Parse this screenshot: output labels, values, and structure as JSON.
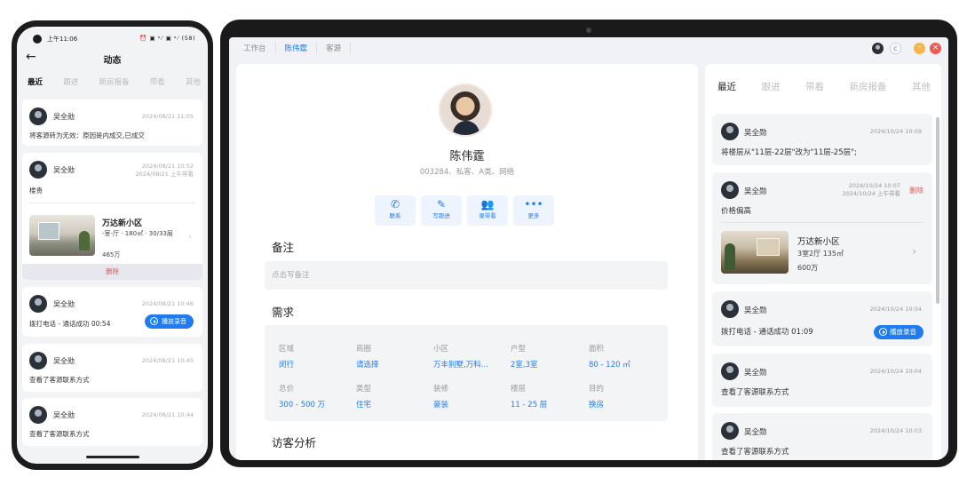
{
  "phone": {
    "status_time": "上午11:06",
    "status_icons": "⏰ ▣ ᵃᵢˡ ▣ ᵃᵢˡ (58)",
    "back_glyph": "←",
    "title": "动态",
    "tabs": [
      "最近",
      "跟进",
      "新房报备",
      "带看",
      "其他"
    ],
    "feed": [
      {
        "name": "吴全勋",
        "date": "2024/08/21 11:05",
        "text": "将客源转为无效：原因是内成交,已成交"
      },
      {
        "name": "吴全勋",
        "date": "2024/08/21 10:52",
        "date2": "2024/08/21 上午带看",
        "text": "楼贵",
        "house": {
          "name": "万达新小区",
          "info": "-室-厅 · 180㎡ · 30/33层",
          "price": "465万"
        },
        "delete_label": "删除"
      },
      {
        "name": "吴全勋",
        "date": "2024/08/21 10:46",
        "text": "拨打电话 - 通话成功 00:54",
        "play_label": "播放录音"
      },
      {
        "name": "吴全勋",
        "date": "2024/08/21 10:45",
        "text": "查看了客源联系方式"
      },
      {
        "name": "吴全勋",
        "date": "2024/08/21 10:44",
        "text": "查看了客源联系方式"
      }
    ]
  },
  "tablet": {
    "tabs": [
      "工作台",
      "陈伟霆",
      "客源"
    ],
    "active_tab": "陈伟霆",
    "window_icons": {
      "refresh": "c",
      "minimize": "–",
      "close": "×"
    },
    "profile": {
      "name": "陈伟霆",
      "sub": "003284、私客、A类、网络"
    },
    "actions": [
      {
        "icon": "phone-icon",
        "glyph": "✆",
        "label": "联系"
      },
      {
        "icon": "pen-icon",
        "glyph": "✎",
        "label": "写跟进"
      },
      {
        "icon": "people-icon",
        "glyph": "👥",
        "label": "录带看"
      },
      {
        "icon": "more-icon",
        "glyph": "•••",
        "label": "更多"
      }
    ],
    "note": {
      "title": "备注",
      "placeholder": "点击写备注"
    },
    "requirements": {
      "title": "需求",
      "fields": [
        {
          "label": "区域",
          "value": "闵行"
        },
        {
          "label": "商圈",
          "value": "请选择"
        },
        {
          "label": "小区",
          "value": "万丰别墅,万科..."
        },
        {
          "label": "户型",
          "value": "2室,3室"
        },
        {
          "label": "面积",
          "value": "80 - 120 ㎡"
        },
        {
          "label": "总价",
          "value": "300 - 500 万"
        },
        {
          "label": "类型",
          "value": "住宅"
        },
        {
          "label": "装修",
          "value": "豪装"
        },
        {
          "label": "楼层",
          "value": "11 - 25 层"
        },
        {
          "label": "目的",
          "value": "换房"
        }
      ]
    },
    "visitor_analysis_title": "访客分析",
    "side": {
      "tabs": [
        "最近",
        "跟进",
        "带看",
        "新房报备",
        "其他"
      ],
      "feed": [
        {
          "name": "吴全勋",
          "date": "2024/10/24 10:09",
          "text": "将楼层从\"11层-22层\"改为\"11层-25层\";"
        },
        {
          "name": "吴全勋",
          "date": "2024/10/24 10:07",
          "date2": "2024/10/24 上午带看",
          "delete_label": "删除",
          "text": "价格偏高",
          "house": {
            "name": "万达新小区",
            "info": "3室2厅   135㎡",
            "price": "600万"
          }
        },
        {
          "name": "吴全勋",
          "date": "2024/10/24 10:04",
          "text": "拨打电话 - 通话成功 01:09",
          "play_label": "播放录音"
        },
        {
          "name": "吴全勋",
          "date": "2024/10/24 10:04",
          "text": "查看了客源联系方式"
        },
        {
          "name": "吴全勋",
          "date": "2024/10/24 10:03",
          "text": "查看了客源联系方式"
        }
      ]
    }
  },
  "colors": {
    "accent": "#1f7cf0",
    "danger": "#e05a5a",
    "muted": "#999999",
    "panel": "#f3f4f6"
  }
}
